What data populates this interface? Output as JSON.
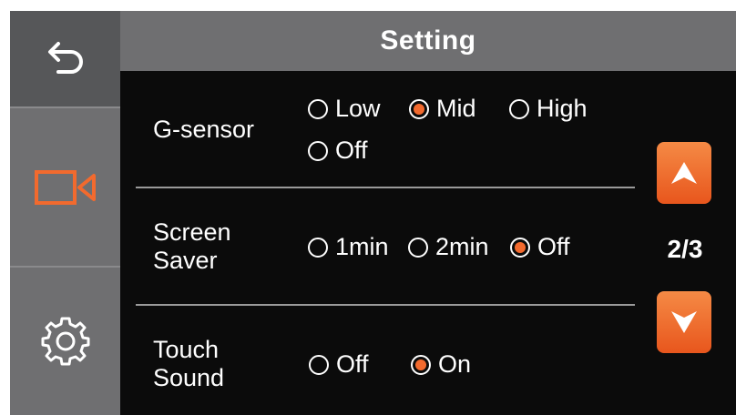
{
  "header": {
    "title": "Setting"
  },
  "sidebar": {
    "items": [
      {
        "name": "back",
        "icon": "back-arrow-icon"
      },
      {
        "name": "record",
        "icon": "video-camera-icon",
        "color": "#f26a2e"
      },
      {
        "name": "settings",
        "icon": "gear-icon"
      }
    ]
  },
  "settings": {
    "gsensor": {
      "label": "G-sensor",
      "options": [
        "Low",
        "Mid",
        "High",
        "Off"
      ],
      "selected": "Mid"
    },
    "screen_saver": {
      "label_line1": "Screen",
      "label_line2": "Saver",
      "options": [
        "1min",
        "2min",
        "Off"
      ],
      "selected": "Off"
    },
    "touch_sound": {
      "label_line1": "Touch",
      "label_line2": "Sound",
      "options": [
        "Off",
        "On"
      ],
      "selected": "On"
    }
  },
  "pagination": {
    "current": "2/3"
  },
  "colors": {
    "accent": "#f26a2e",
    "panel": "#6f6f71",
    "background": "#0b0b0b"
  }
}
